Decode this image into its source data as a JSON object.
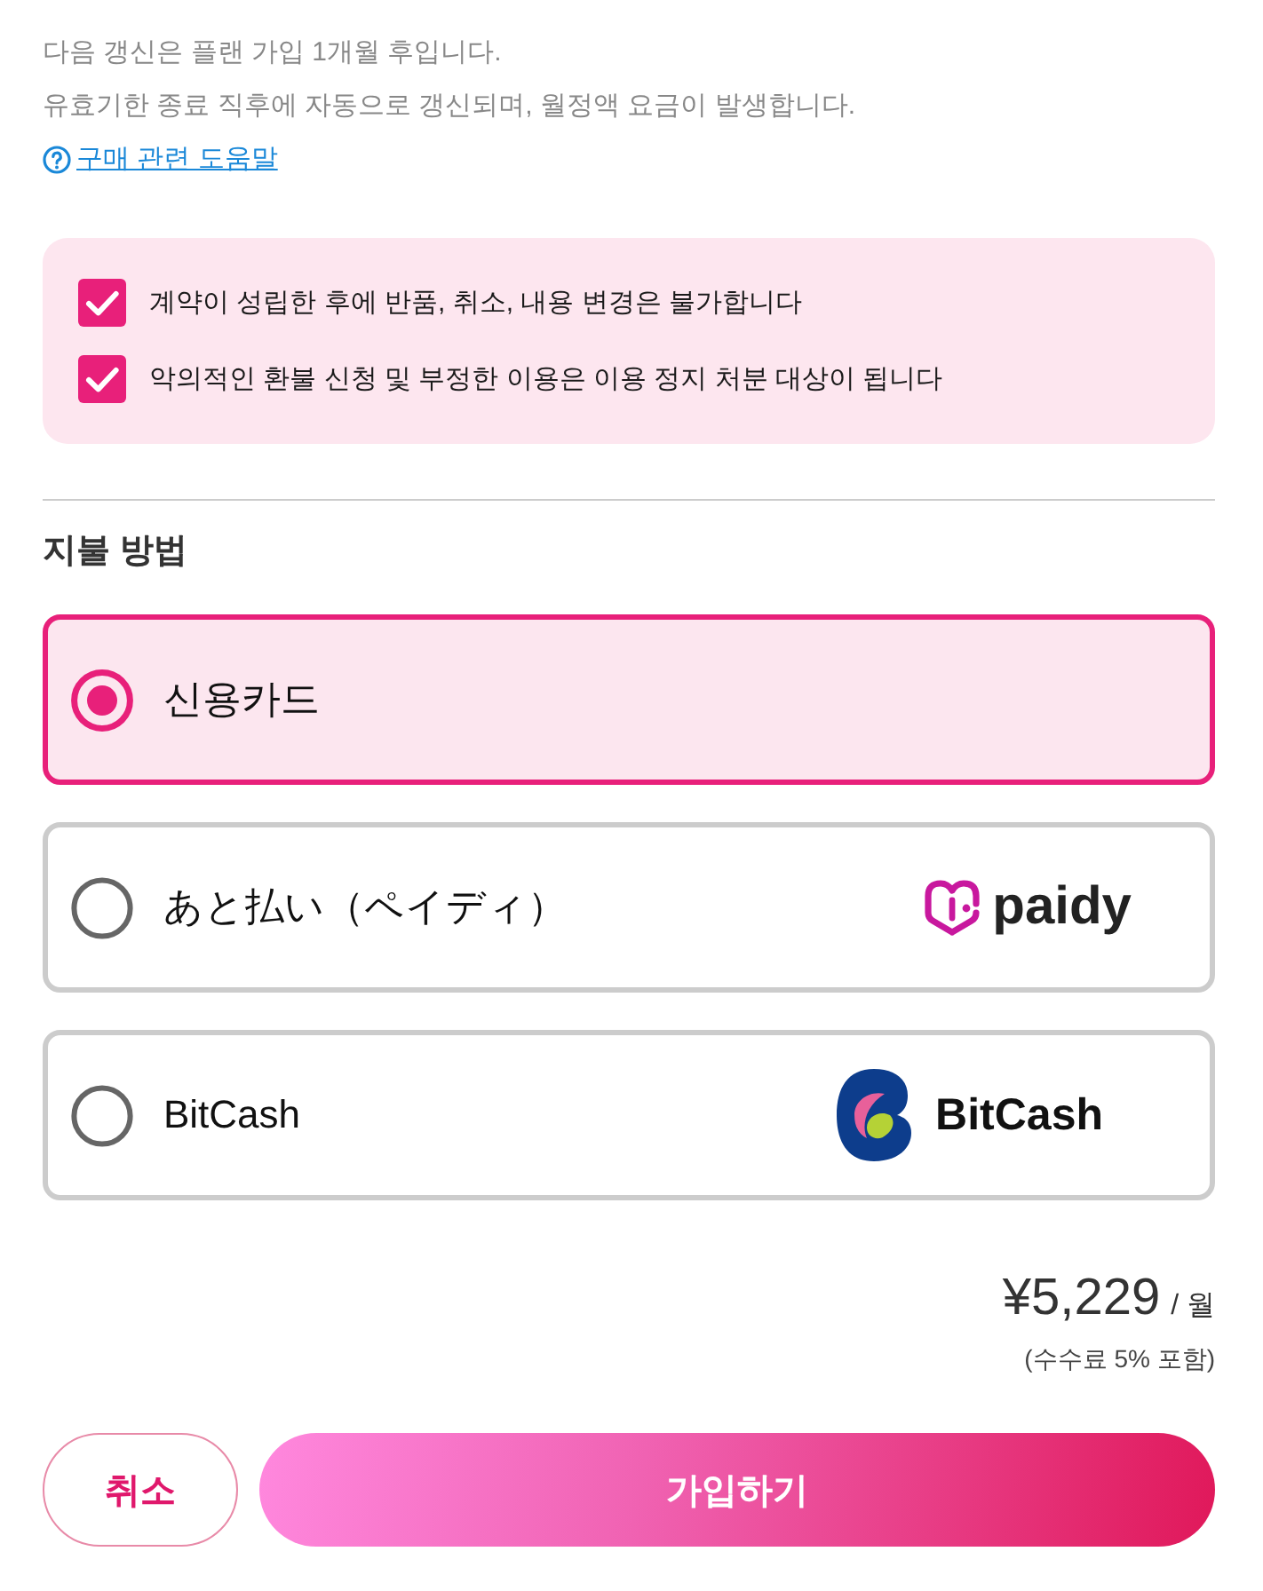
{
  "notice": {
    "lines": [
      "다음 갱신은 플랜 가입 1개월 후입니다.",
      "유효기한 종료 직후에 자동으로 갱신되며, 월정액 요금이 발생합니다."
    ],
    "help_link": "구매 관련 도움말"
  },
  "agreements": [
    {
      "label": "계약이 성립한 후에 반품, 취소, 내용 변경은 불가합니다",
      "checked": true
    },
    {
      "label": "악의적인 환불 신청 및 부정한 이용은 이용 정지 처분 대상이 됩니다",
      "checked": true
    }
  ],
  "payment": {
    "title": "지불 방법",
    "options": [
      {
        "label": "신용카드",
        "selected": true
      },
      {
        "label": "あと払い（ペイディ）",
        "selected": false,
        "logo": {
          "kind": "paidy",
          "text": "paidy"
        }
      },
      {
        "label": "BitCash",
        "selected": false,
        "logo": {
          "kind": "bitcash",
          "text": "BitCash"
        }
      }
    ]
  },
  "price": {
    "amount": "¥5,229",
    "period": "/ 월",
    "note": "(수수료 5% 포함)"
  },
  "buttons": [
    {
      "label": "취소",
      "kind": "secondary"
    },
    {
      "label": "가입하기",
      "kind": "primary"
    }
  ]
}
